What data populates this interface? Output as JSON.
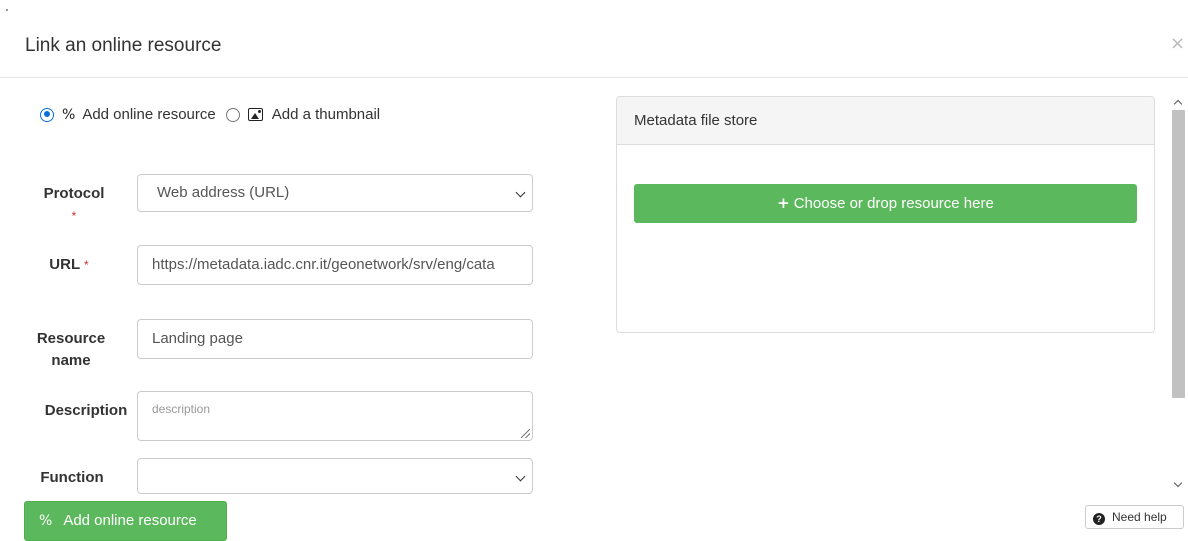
{
  "modal": {
    "title": "Link an online resource",
    "close_glyph": "×"
  },
  "mode": {
    "options": [
      {
        "label": "Add online resource",
        "selected": true,
        "icon": "link-icon"
      },
      {
        "label": "Add a thumbnail",
        "selected": false,
        "icon": "image-icon"
      }
    ]
  },
  "form": {
    "protocol": {
      "label": "Protocol",
      "required_mark": "*",
      "value": "Web address (URL)"
    },
    "url": {
      "label": "URL",
      "required_mark": "*",
      "value": "https://metadata.iadc.cnr.it/geonetwork/srv/eng/cata"
    },
    "resource_name": {
      "label_line1": "Resource",
      "label_line2": "name",
      "value": "Landing page"
    },
    "description": {
      "label": "Description",
      "placeholder": "description"
    },
    "function": {
      "label": "Function",
      "value": ""
    }
  },
  "actions": {
    "add_label": "Add online resource",
    "help_label": "Need help",
    "help_glyph": "?"
  },
  "store": {
    "heading": "Metadata file store",
    "drop_label": "Choose or drop resource here",
    "plus_glyph": "+"
  },
  "colors": {
    "primary_green": "#5cb85c",
    "radio_blue": "#0b6fd6",
    "required_red": "#c9302c"
  }
}
